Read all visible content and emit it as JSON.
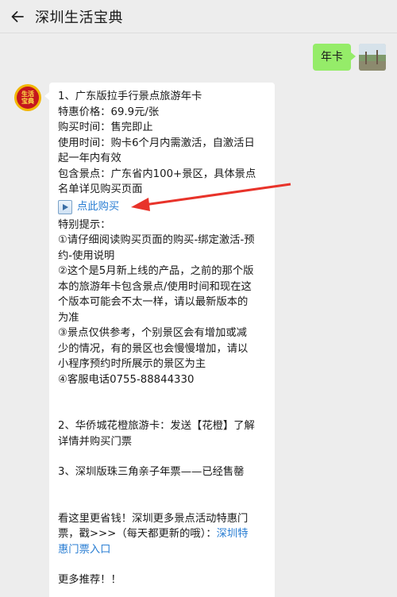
{
  "header": {
    "title": "深圳生活宝典",
    "back_icon": "back-arrow-icon"
  },
  "user_message": {
    "text": "年卡"
  },
  "bot_avatar": {
    "text": "生活\n宝典"
  },
  "bot_message": {
    "item1_title": "1、广东版拉手行景点旅游年卡",
    "price": "特惠价格：69.9元/张",
    "buy_time": "购买时间：售完即止",
    "use_time_1": "使用时间：购卡6个月内需激活，自激活日",
    "use_time_2": "起一年内有效",
    "scenic_1": "包含景点：广东省内100+景区，具体景点",
    "scenic_2": "名单详见购买页面",
    "buy_link": "点此购买",
    "tips_title": "特别提示：",
    "tip1_1": "①请仔细阅读购买页面的购买-绑定激活-预",
    "tip1_2": "约-使用说明",
    "tip2_1": "②这个是5月新上线的产品，之前的那个版",
    "tip2_2": "本的旅游年卡包含景点/使用时间和现在这",
    "tip2_3": "个版本可能会不太一样，请以最新版本的",
    "tip2_4": "为准",
    "tip3_1": "③景点仅供参考，个别景区会有增加或减",
    "tip3_2": "少的情况，有的景区也会慢慢增加，请以",
    "tip3_3": "小程序预约时所展示的景区为主",
    "tip4": "④客服电话0755-88844330",
    "item2_1": "2、华侨城花橙旅游卡：发送【花橙】了解",
    "item2_2": "详情并购买门票",
    "item3": "3、深圳版珠三角亲子年票——已经售罄",
    "promo_1": "看这里更省钱！深圳更多景点活动特惠门",
    "promo_2a": "票，戳>>>（每天都更新的哦）：",
    "promo_2b": "深圳特",
    "promo_3": "惠门票入口",
    "more": "更多推荐！！"
  },
  "colors": {
    "user_bubble": "#95ec69",
    "link": "#2a7ed3",
    "annotation_arrow": "#e8332a"
  }
}
